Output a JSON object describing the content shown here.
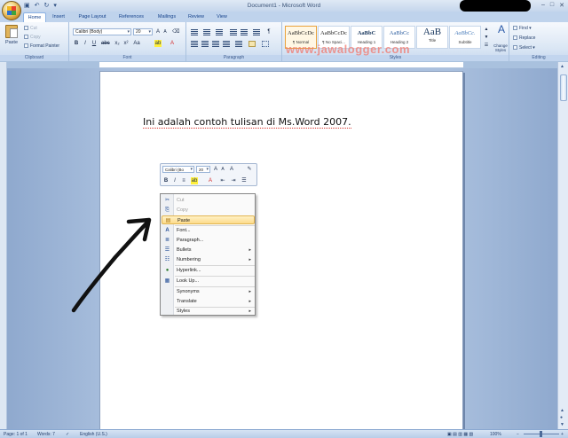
{
  "window": {
    "title": "Document1 - Microsoft Word",
    "controls": [
      "–",
      "□",
      "✕"
    ]
  },
  "tabs": [
    "Home",
    "Insert",
    "Page Layout",
    "References",
    "Mailings",
    "Review",
    "View"
  ],
  "ribbon": {
    "clipboard": {
      "label": "Clipboard",
      "paste": "Paste",
      "cut": "Cut",
      "copy": "Copy",
      "format_painter": "Format Painter"
    },
    "font": {
      "label": "Font",
      "font_name": "Calibri (Body)",
      "font_size": "20"
    },
    "paragraph": {
      "label": "Paragraph"
    },
    "styles": {
      "label": "Styles",
      "items": [
        {
          "sample": "AaBbCcDc",
          "name": "¶ Normal"
        },
        {
          "sample": "AaBbCcDc",
          "name": "¶ No Spaci..."
        },
        {
          "sample": "AaBbC",
          "name": "Heading 1"
        },
        {
          "sample": "AaBbCc",
          "name": "Heading 2"
        },
        {
          "sample": "AaB",
          "name": "Title"
        },
        {
          "sample": "AaBbCc.",
          "name": "Subtitle"
        }
      ],
      "change_styles": "Change Styles"
    },
    "editing": {
      "label": "Editing",
      "find": "Find",
      "replace": "Replace",
      "select": "Select"
    }
  },
  "watermark": "www.jawalogger.com",
  "document": {
    "text": "Ini adalah contoh tulisan di Ms.Word 2007."
  },
  "mini_toolbar": {
    "font_name": "Calibri (Bo",
    "font_size": "20"
  },
  "context_menu": {
    "items": [
      {
        "label": "Cut",
        "enabled": false
      },
      {
        "label": "Copy",
        "enabled": false
      },
      {
        "label": "Paste",
        "enabled": true,
        "highlighted": true
      },
      {
        "label": "Font...",
        "enabled": true
      },
      {
        "label": "Paragraph...",
        "enabled": true
      },
      {
        "label": "Bullets",
        "enabled": true,
        "submenu": true
      },
      {
        "label": "Numbering",
        "enabled": true,
        "submenu": true
      },
      {
        "label": "Hyperlink...",
        "enabled": true
      },
      {
        "label": "Look Up...",
        "enabled": true
      },
      {
        "label": "Synonyms",
        "enabled": true,
        "submenu": true
      },
      {
        "label": "Translate",
        "enabled": true,
        "submenu": true
      },
      {
        "label": "Styles",
        "enabled": true,
        "submenu": true
      }
    ]
  },
  "status_bar": {
    "page": "Page: 1 of 1",
    "words": "Words: 7",
    "language": "English (U.S.)",
    "zoom": "100%"
  },
  "colors": {
    "ribbon_accent": "#15428b",
    "menu_highlight": "#fddb8a",
    "watermark": "#f0786e"
  }
}
